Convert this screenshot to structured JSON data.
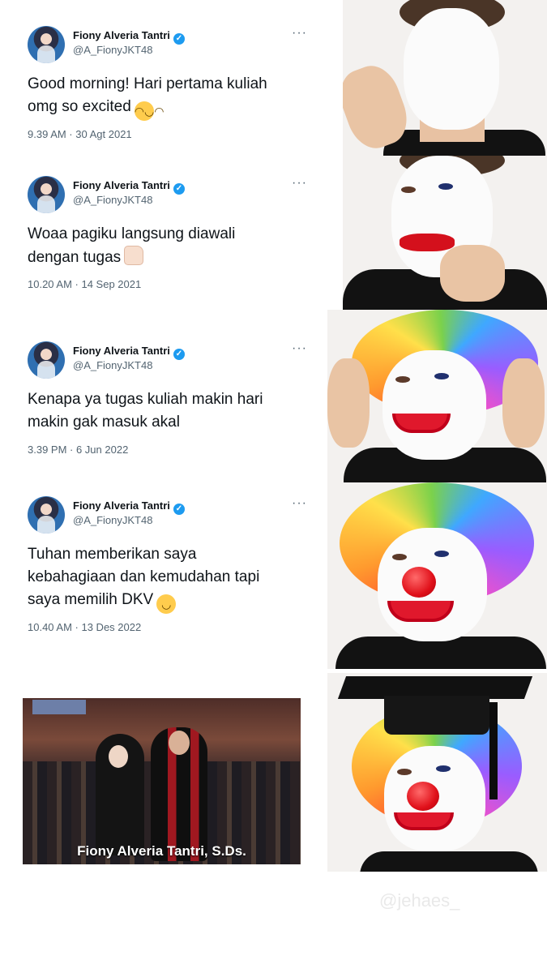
{
  "tweets": [
    {
      "name": "Fiony Alveria Tantri",
      "handle": "@A_FionyJKT48",
      "more": "···",
      "text_line1": "Good morning! Hari pertama kuliah",
      "text_line2": "omg so excited",
      "emoji": "laughing-emoji",
      "meta": "9.39 AM · 30 Agt 2021"
    },
    {
      "name": "Fiony Alveria Tantri",
      "handle": "@A_FionyJKT48",
      "more": "···",
      "text_line1": "Woaa pagiku langsung diawali",
      "text_line2": "dengan tugas",
      "emoji": "thumbs-up-emoji",
      "meta": "10.20 AM · 14 Sep 2021"
    },
    {
      "name": "Fiony Alveria Tantri",
      "handle": "@A_FionyJKT48",
      "more": "···",
      "text_line1": "Kenapa ya tugas kuliah makin hari",
      "text_line2": "makin gak masuk akal",
      "meta": "3.39 PM · 6 Jun 2022"
    },
    {
      "name": "Fiony Alveria Tantri",
      "handle": "@A_FionyJKT48",
      "more": "···",
      "text_line1": "Tuhan memberikan saya",
      "text_line2": "kebahagiaan dan kemudahan tapi",
      "text_line3": "saya memilih DKV",
      "emoji": "crying-smile-emoji",
      "meta": "10.40 AM · 13 Des 2022"
    }
  ],
  "graduation_photo": {
    "caption": "Fiony Alveria Tantri, S.Ds."
  },
  "watermark": "@jehaes_",
  "icons": {
    "verified": "verified-badge-icon",
    "more": "more-options-icon"
  }
}
